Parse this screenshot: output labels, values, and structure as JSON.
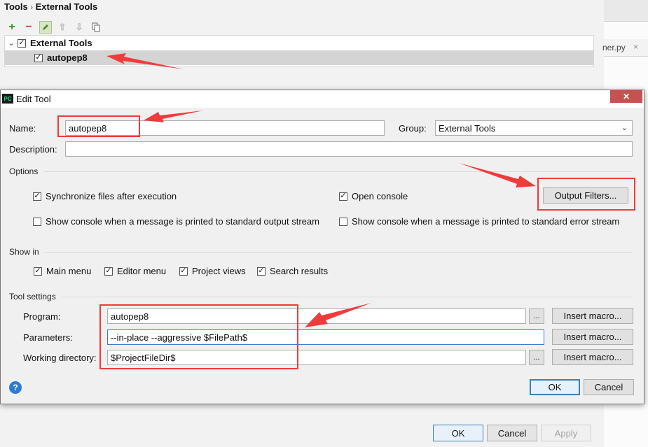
{
  "background": {
    "breadcrumb": {
      "root": "Tools",
      "sep": "›",
      "leaf": "External Tools"
    },
    "toolbar": {
      "add": "+",
      "remove": "−",
      "up": "⇧",
      "down": "⇩"
    },
    "tree": {
      "group": "External Tools",
      "item": "autopep8",
      "checkmark": "✓",
      "expand": "⌄"
    },
    "right_tab": {
      "label": "ner.py",
      "close": "×"
    },
    "buttons": {
      "ok": "OK",
      "cancel": "Cancel",
      "apply": "Apply"
    }
  },
  "dialog": {
    "title": "Edit Tool",
    "app_icon": "PC",
    "close": "✕",
    "name_label": "Name:",
    "name_value": "autopep8",
    "group_label": "Group:",
    "group_value": "External Tools",
    "description_label": "Description:",
    "description_value": "",
    "options_title": "Options",
    "sync_files": "Synchronize files after execution",
    "open_console": "Open console",
    "output_filters": "Output Filters...",
    "show_console_stdout": "Show console when a message is printed to standard output stream",
    "show_console_stderr": "Show console when a message is printed to standard error stream",
    "show_in_title": "Show in",
    "main_menu": "Main menu",
    "editor_menu": "Editor menu",
    "project_views": "Project views",
    "search_results": "Search results",
    "tool_settings_title": "Tool settings",
    "program_label": "Program:",
    "program_value": "autopep8",
    "parameters_label": "Parameters:",
    "parameters_value": "--in-place --aggressive  $FilePath$",
    "workdir_label": "Working directory:",
    "workdir_value": "$ProjectFileDir$",
    "browse": "...",
    "insert_macro": "Insert macro...",
    "ok": "OK",
    "cancel": "Cancel",
    "help": "?",
    "checkmark": "✓",
    "dropdown": "⌄"
  },
  "colors": {
    "annotation": "#ef3b3b",
    "accent": "#3c7fb1"
  }
}
